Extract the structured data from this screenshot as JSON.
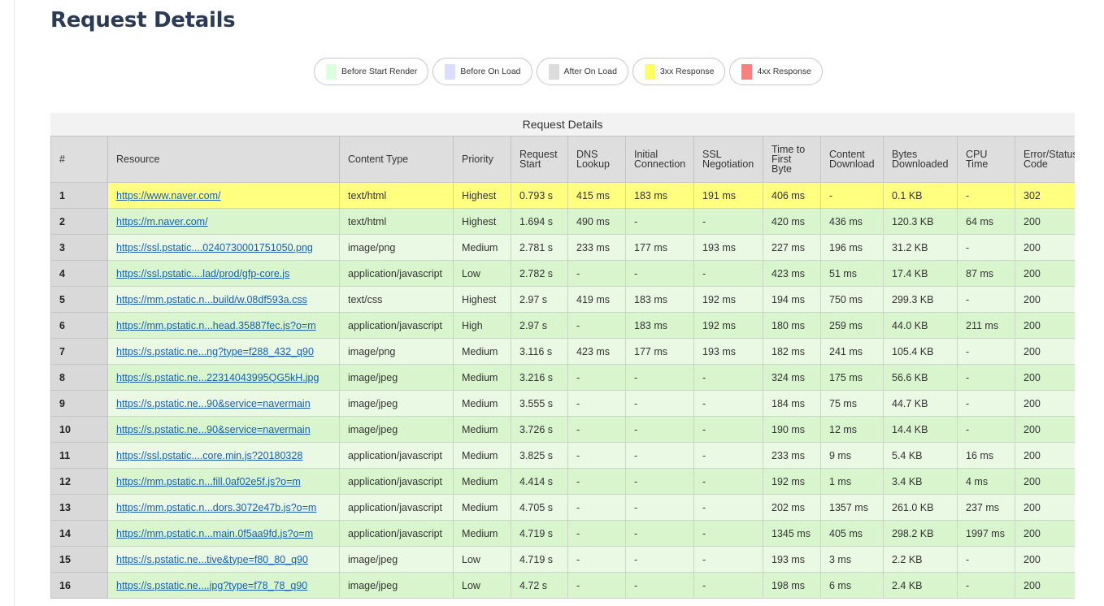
{
  "page_title": "Request Details",
  "legend": [
    {
      "label": "Before Start Render",
      "color": "#dcffdc"
    },
    {
      "label": "Before On Load",
      "color": "#dcdcff"
    },
    {
      "label": "After On Load",
      "color": "#dcdcdc"
    },
    {
      "label": "3xx Response",
      "color": "#ffff60"
    },
    {
      "label": "4xx Response",
      "color": "#f88080"
    }
  ],
  "table": {
    "caption": "Request Details",
    "headers": {
      "num": "#",
      "resource": "Resource",
      "content_type": "Content Type",
      "priority": "Priority",
      "request_start": "Request Start",
      "dns_lookup": "DNS Lookup",
      "initial_connection": "Initial Connection",
      "ssl_negotiation": "SSL Negotiation",
      "ttfb": "Time to First Byte",
      "content_download": "Content Download",
      "bytes_downloaded": "Bytes Downloaded",
      "cpu_time": "CPU Time",
      "status": "Error/Status Code"
    },
    "rows": [
      {
        "num": "1",
        "resource": "https://www.naver.com/",
        "content_type": "text/html",
        "priority": "Highest",
        "request_start": "0.793 s",
        "dns": "415 ms",
        "conn": "183 ms",
        "ssl": "191 ms",
        "ttfb": "406 ms",
        "download": "-",
        "bytes": "0.1 KB",
        "cpu": "-",
        "status": "302",
        "kind": "3xx"
      },
      {
        "num": "2",
        "resource": "https://m.naver.com/",
        "content_type": "text/html",
        "priority": "Highest",
        "request_start": "1.694 s",
        "dns": "490 ms",
        "conn": "-",
        "ssl": "-",
        "ttfb": "420 ms",
        "download": "436 ms",
        "bytes": "120.3 KB",
        "cpu": "64 ms",
        "status": "200",
        "kind": "ok"
      },
      {
        "num": "3",
        "resource": "https://ssl.pstatic....0240730001751050.png",
        "content_type": "image/png",
        "priority": "Medium",
        "request_start": "2.781 s",
        "dns": "233 ms",
        "conn": "177 ms",
        "ssl": "193 ms",
        "ttfb": "227 ms",
        "download": "196 ms",
        "bytes": "31.2 KB",
        "cpu": "-",
        "status": "200",
        "kind": "ok"
      },
      {
        "num": "4",
        "resource": "https://ssl.pstatic....lad/prod/gfp-core.js",
        "content_type": "application/javascript",
        "priority": "Low",
        "request_start": "2.782 s",
        "dns": "-",
        "conn": "-",
        "ssl": "-",
        "ttfb": "423 ms",
        "download": "51 ms",
        "bytes": "17.4 KB",
        "cpu": "87 ms",
        "status": "200",
        "kind": "ok"
      },
      {
        "num": "5",
        "resource": "https://mm.pstatic.n...build/w.08df593a.css",
        "content_type": "text/css",
        "priority": "Highest",
        "request_start": "2.97 s",
        "dns": "419 ms",
        "conn": "183 ms",
        "ssl": "192 ms",
        "ttfb": "194 ms",
        "download": "750 ms",
        "bytes": "299.3 KB",
        "cpu": "-",
        "status": "200",
        "kind": "ok"
      },
      {
        "num": "6",
        "resource": "https://mm.pstatic.n...head.35887fec.js?o=m",
        "content_type": "application/javascript",
        "priority": "High",
        "request_start": "2.97 s",
        "dns": "-",
        "conn": "183 ms",
        "ssl": "192 ms",
        "ttfb": "180 ms",
        "download": "259 ms",
        "bytes": "44.0 KB",
        "cpu": "211 ms",
        "status": "200",
        "kind": "ok"
      },
      {
        "num": "7",
        "resource": "https://s.pstatic.ne...ng?type=f288_432_q90",
        "content_type": "image/png",
        "priority": "Medium",
        "request_start": "3.116 s",
        "dns": "423 ms",
        "conn": "177 ms",
        "ssl": "193 ms",
        "ttfb": "182 ms",
        "download": "241 ms",
        "bytes": "105.4 KB",
        "cpu": "-",
        "status": "200",
        "kind": "ok"
      },
      {
        "num": "8",
        "resource": "https://s.pstatic.ne...22314043995QG5kH.jpg",
        "content_type": "image/jpeg",
        "priority": "Medium",
        "request_start": "3.216 s",
        "dns": "-",
        "conn": "-",
        "ssl": "-",
        "ttfb": "324 ms",
        "download": "175 ms",
        "bytes": "56.6 KB",
        "cpu": "-",
        "status": "200",
        "kind": "ok"
      },
      {
        "num": "9",
        "resource": "https://s.pstatic.ne...90&service=navermain",
        "content_type": "image/jpeg",
        "priority": "Medium",
        "request_start": "3.555 s",
        "dns": "-",
        "conn": "-",
        "ssl": "-",
        "ttfb": "184 ms",
        "download": "75 ms",
        "bytes": "44.7 KB",
        "cpu": "-",
        "status": "200",
        "kind": "ok"
      },
      {
        "num": "10",
        "resource": "https://s.pstatic.ne...90&service=navermain",
        "content_type": "image/jpeg",
        "priority": "Medium",
        "request_start": "3.726 s",
        "dns": "-",
        "conn": "-",
        "ssl": "-",
        "ttfb": "190 ms",
        "download": "12 ms",
        "bytes": "14.4 KB",
        "cpu": "-",
        "status": "200",
        "kind": "ok"
      },
      {
        "num": "11",
        "resource": "https://ssl.pstatic....core.min.js?20180328",
        "content_type": "application/javascript",
        "priority": "Medium",
        "request_start": "3.825 s",
        "dns": "-",
        "conn": "-",
        "ssl": "-",
        "ttfb": "233 ms",
        "download": "9 ms",
        "bytes": "5.4 KB",
        "cpu": "16 ms",
        "status": "200",
        "kind": "ok"
      },
      {
        "num": "12",
        "resource": "https://mm.pstatic.n...fill.0af02e5f.js?o=m",
        "content_type": "application/javascript",
        "priority": "Medium",
        "request_start": "4.414 s",
        "dns": "-",
        "conn": "-",
        "ssl": "-",
        "ttfb": "192 ms",
        "download": "1 ms",
        "bytes": "3.4 KB",
        "cpu": "4 ms",
        "status": "200",
        "kind": "ok"
      },
      {
        "num": "13",
        "resource": "https://mm.pstatic.n...dors.3072e47b.js?o=m",
        "content_type": "application/javascript",
        "priority": "Medium",
        "request_start": "4.705 s",
        "dns": "-",
        "conn": "-",
        "ssl": "-",
        "ttfb": "202 ms",
        "download": "1357 ms",
        "bytes": "261.0 KB",
        "cpu": "237 ms",
        "status": "200",
        "kind": "ok"
      },
      {
        "num": "14",
        "resource": "https://mm.pstatic.n...main.0f5aa9fd.js?o=m",
        "content_type": "application/javascript",
        "priority": "Medium",
        "request_start": "4.719 s",
        "dns": "-",
        "conn": "-",
        "ssl": "-",
        "ttfb": "1345 ms",
        "download": "405 ms",
        "bytes": "298.2 KB",
        "cpu": "1997 ms",
        "status": "200",
        "kind": "ok"
      },
      {
        "num": "15",
        "resource": "https://s.pstatic.ne...tive&type=f80_80_q90",
        "content_type": "image/jpeg",
        "priority": "Low",
        "request_start": "4.719 s",
        "dns": "-",
        "conn": "-",
        "ssl": "-",
        "ttfb": "193 ms",
        "download": "3 ms",
        "bytes": "2.2 KB",
        "cpu": "-",
        "status": "200",
        "kind": "ok"
      },
      {
        "num": "16",
        "resource": "https://s.pstatic.ne....jpg?type=f78_78_q90",
        "content_type": "image/jpeg",
        "priority": "Low",
        "request_start": "4.72 s",
        "dns": "-",
        "conn": "-",
        "ssl": "-",
        "ttfb": "198 ms",
        "download": "6 ms",
        "bytes": "2.4 KB",
        "cpu": "-",
        "status": "200",
        "kind": "ok"
      }
    ]
  }
}
